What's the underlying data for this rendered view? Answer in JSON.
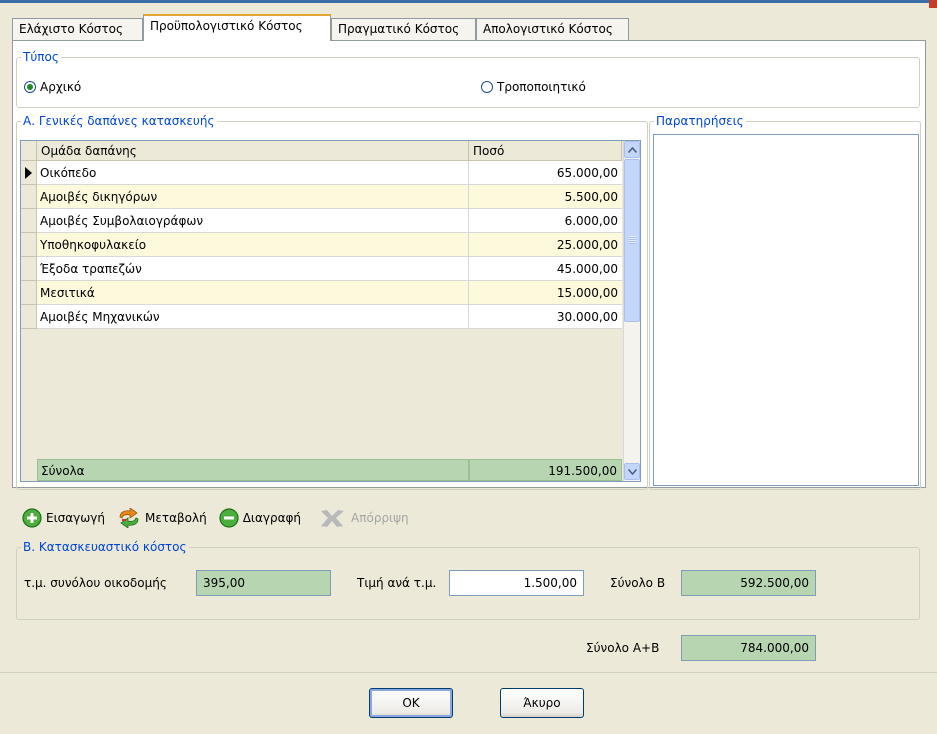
{
  "tabs": [
    {
      "label": "Ελάχιστο Κόστος"
    },
    {
      "label": "Προϋπολογιστικό Κόστος",
      "active": true
    },
    {
      "label": "Πραγματικό Κόστος"
    },
    {
      "label": "Απολογιστικό Κόστος"
    }
  ],
  "type_group": {
    "legend": "Τύπος",
    "options": [
      {
        "label": "Αρχικό",
        "selected": true
      },
      {
        "label": "Τροποποιητικό",
        "selected": false
      }
    ]
  },
  "section_a": {
    "legend": "Α. Γενικές δαπάνες κατασκευής",
    "columns": [
      "Ομάδα δαπάνης",
      "Ποσό"
    ],
    "rows": [
      {
        "group": "Οικόπεδο",
        "amount": "65.000,00"
      },
      {
        "group": "Αμοιβές δικηγόρων",
        "amount": "5.500,00"
      },
      {
        "group": "Αμοιβές Συμβολαιογράφων",
        "amount": "6.000,00"
      },
      {
        "group": "Υποθηκοφυλακείο",
        "amount": "25.000,00"
      },
      {
        "group": "Έξοδα τραπεζών",
        "amount": "45.000,00"
      },
      {
        "group": "Μεσιτικά",
        "amount": "15.000,00"
      },
      {
        "group": "Αμοιβές Μηχανικών",
        "amount": "30.000,00"
      }
    ],
    "totals_label": "Σύνολα",
    "totals_amount": "191.500,00"
  },
  "notes": {
    "legend": "Παρατηρήσεις",
    "value": ""
  },
  "toolbar": {
    "insert": "Εισαγωγή",
    "modify": "Μεταβολή",
    "delete": "Διαγραφή",
    "reject": "Απόρριψη"
  },
  "section_b": {
    "legend": "Β. Κατασκευαστικό κόστος",
    "area_label": "τ.μ. συνόλου οικοδομής",
    "area_value": "395,00",
    "price_label": "Τιμή ανά τ.μ.",
    "price_value": "1.500,00",
    "total_b_label": "Σύνολο Β",
    "total_b_value": "592.500,00"
  },
  "total_ab": {
    "label": "Σύνολο Α+Β",
    "value": "784.000,00"
  },
  "buttons": {
    "ok": "OK",
    "cancel": "Άκυρο"
  },
  "colors": {
    "accent": "#0046d5",
    "total_bg": "#b6d5b0",
    "alt_row": "#fdf9dc",
    "active_tab": "#e6a431"
  }
}
